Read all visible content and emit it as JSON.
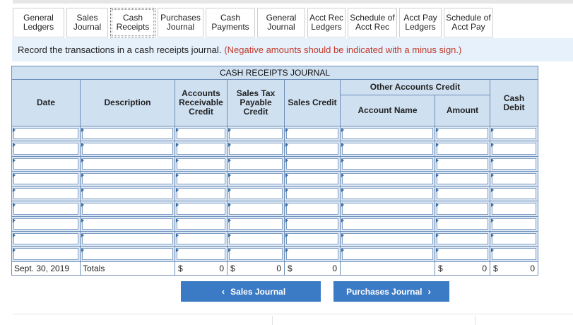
{
  "tabs": [
    {
      "label": "General\nLedgers",
      "active": false
    },
    {
      "label": "Sales\nJournal",
      "active": false
    },
    {
      "label": "Cash\nReceipts",
      "active": true
    },
    {
      "label": "Purchases\nJournal",
      "active": false
    },
    {
      "label": "Cash\nPayments",
      "active": false
    },
    {
      "label": "General\nJournal",
      "active": false
    },
    {
      "label": "Acct Rec\nLedgers",
      "active": false
    },
    {
      "label": "Schedule of\nAcct Rec",
      "active": false
    },
    {
      "label": "Acct Pay\nLedgers",
      "active": false
    },
    {
      "label": "Schedule of\nAcct Pay",
      "active": false
    }
  ],
  "instruction": {
    "text": "Record the transactions in a cash receipts journal.",
    "note": "(Negative amounts should be indicated with a minus sign.)"
  },
  "journal": {
    "title": "CASH RECEIPTS JOURNAL",
    "headers": {
      "date": "Date",
      "description": "Description",
      "accounts_receivable": "Accounts\nReceivable\nCredit",
      "sales_tax": "Sales Tax\nPayable\nCredit",
      "sales_credit": "Sales Credit",
      "other_accounts": "Other Accounts Credit",
      "account_name": "Account Name",
      "amount": "Amount",
      "cash_debit": "Cash\nDebit"
    },
    "entry_rows": 9,
    "totals": {
      "date": "Sept. 30, 2019",
      "label": "Totals",
      "currency": "$",
      "accounts_receivable": "0",
      "sales_tax": "0",
      "sales_credit": "0",
      "amount": "0",
      "cash_debit": "0"
    }
  },
  "nav": {
    "prev_label": "Sales Journal",
    "next_label": "Purchases Journal"
  }
}
